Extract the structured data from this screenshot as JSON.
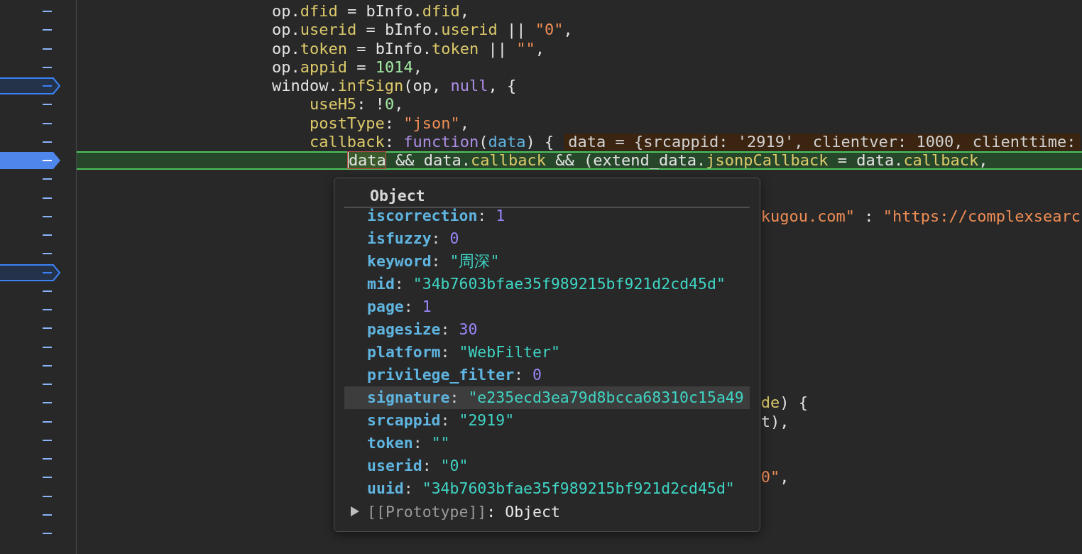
{
  "editor": {
    "rows": [
      {
        "breakpoint": false,
        "current": false,
        "tokens": [
          {
            "text": "                    op.",
            "kind": "plain"
          },
          {
            "text": "dfid",
            "kind": "prop"
          },
          {
            "text": " = bInfo.",
            "kind": "plain"
          },
          {
            "text": "dfid",
            "kind": "prop"
          },
          {
            "text": ",",
            "kind": "plain"
          }
        ]
      },
      {
        "breakpoint": false,
        "current": false,
        "tokens": [
          {
            "text": "                    op.",
            "kind": "plain"
          },
          {
            "text": "userid",
            "kind": "prop"
          },
          {
            "text": " = bInfo.",
            "kind": "plain"
          },
          {
            "text": "userid",
            "kind": "prop"
          },
          {
            "text": " || ",
            "kind": "plain"
          },
          {
            "text": "\"0\"",
            "kind": "string"
          },
          {
            "text": ",",
            "kind": "plain"
          }
        ]
      },
      {
        "breakpoint": false,
        "current": false,
        "tokens": [
          {
            "text": "                    op.",
            "kind": "plain"
          },
          {
            "text": "token",
            "kind": "prop"
          },
          {
            "text": " = bInfo.",
            "kind": "plain"
          },
          {
            "text": "token",
            "kind": "prop"
          },
          {
            "text": " || ",
            "kind": "plain"
          },
          {
            "text": "\"\"",
            "kind": "string"
          },
          {
            "text": ",",
            "kind": "plain"
          }
        ]
      },
      {
        "breakpoint": false,
        "current": false,
        "tokens": [
          {
            "text": "                    op.",
            "kind": "plain"
          },
          {
            "text": "appid",
            "kind": "prop"
          },
          {
            "text": " = ",
            "kind": "plain"
          },
          {
            "text": "1014",
            "kind": "number"
          },
          {
            "text": ",",
            "kind": "plain"
          }
        ]
      },
      {
        "breakpoint": true,
        "current": false,
        "tokens": [
          {
            "text": "                    window.",
            "kind": "plain"
          },
          {
            "text": "infSign",
            "kind": "prop"
          },
          {
            "text": "(op, ",
            "kind": "plain"
          },
          {
            "text": "null",
            "kind": "keyword"
          },
          {
            "text": ", {",
            "kind": "plain"
          }
        ]
      },
      {
        "breakpoint": false,
        "current": false,
        "tokens": [
          {
            "text": "                        useH5",
            "kind": "prop"
          },
          {
            "text": ": !",
            "kind": "plain"
          },
          {
            "text": "0",
            "kind": "number"
          },
          {
            "text": ",",
            "kind": "plain"
          }
        ]
      },
      {
        "breakpoint": false,
        "current": false,
        "tokens": [
          {
            "text": "                        postType",
            "kind": "prop"
          },
          {
            "text": ": ",
            "kind": "plain"
          },
          {
            "text": "\"json\"",
            "kind": "string"
          },
          {
            "text": ",",
            "kind": "plain"
          }
        ]
      },
      {
        "breakpoint": false,
        "current": false,
        "tokens": [
          {
            "text": "                        callback",
            "kind": "prop"
          },
          {
            "text": ": ",
            "kind": "plain"
          },
          {
            "text": "function",
            "kind": "keyword"
          },
          {
            "text": "(",
            "kind": "plain"
          },
          {
            "text": "data",
            "kind": "param"
          },
          {
            "text": ") {",
            "kind": "plain"
          }
        ],
        "inline_value": "data = {srcappid: '2919', clientver: 1000, clienttime:"
      },
      {
        "breakpoint": true,
        "current": true,
        "tokens": [
          {
            "text": "                            data",
            "kind": "hover"
          },
          {
            "text": " && data.",
            "kind": "plain"
          },
          {
            "text": "callback",
            "kind": "prop"
          },
          {
            "text": " && (extend_data.",
            "kind": "plain"
          },
          {
            "text": "jsonpCallback",
            "kind": "prop"
          },
          {
            "text": " = data.",
            "kind": "plain"
          },
          {
            "text": "callback",
            "kind": "prop"
          },
          {
            "text": ",",
            "kind": "plain"
          }
        ]
      },
      {
        "breakpoint": false,
        "current": false
      },
      {
        "breakpoint": false,
        "current": false
      },
      {
        "breakpoint": false,
        "current": false,
        "tokens": [
          {
            "text": "                                                                        kugou.com\"",
            "kind": "string"
          },
          {
            "text": " : ",
            "kind": "plain"
          },
          {
            "text": "\"https://complexsearc",
            "kind": "string"
          }
        ]
      },
      {
        "breakpoint": false,
        "current": false
      },
      {
        "breakpoint": false,
        "current": false
      },
      {
        "breakpoint": true,
        "current": false
      },
      {
        "breakpoint": false,
        "current": false
      },
      {
        "breakpoint": false,
        "current": false
      },
      {
        "breakpoint": false,
        "current": false
      },
      {
        "breakpoint": false,
        "current": false
      },
      {
        "breakpoint": false,
        "current": false
      },
      {
        "breakpoint": false,
        "current": false
      },
      {
        "breakpoint": false,
        "current": false,
        "tokens": [
          {
            "text": "                                                                        de",
            "kind": "prop"
          },
          {
            "text": ") {",
            "kind": "plain"
          }
        ]
      },
      {
        "breakpoint": false,
        "current": false,
        "tokens": [
          {
            "text": "                                                                        t),",
            "kind": "plain"
          }
        ]
      },
      {
        "breakpoint": false,
        "current": false
      },
      {
        "breakpoint": false,
        "current": false
      },
      {
        "breakpoint": false,
        "current": false,
        "tokens": [
          {
            "text": "                                                                        0\"",
            "kind": "string"
          },
          {
            "text": ",",
            "kind": "plain"
          }
        ]
      },
      {
        "breakpoint": false,
        "current": false
      },
      {
        "breakpoint": false,
        "current": false
      },
      {
        "breakpoint": false,
        "current": false
      }
    ]
  },
  "popover": {
    "title": "Object",
    "properties": [
      {
        "key": "iscorrection:",
        "value": "1",
        "kind": "number",
        "selected": false
      },
      {
        "key": "isfuzzy:",
        "value": "0",
        "kind": "number",
        "selected": false
      },
      {
        "key": "keyword:",
        "value": "\"周深\"",
        "kind": "string",
        "selected": false
      },
      {
        "key": "mid:",
        "value": "\"34b7603bfae35f989215bf921d2cd45d\"",
        "kind": "string",
        "selected": false
      },
      {
        "key": "page:",
        "value": "1",
        "kind": "number",
        "selected": false
      },
      {
        "key": "pagesize:",
        "value": "30",
        "kind": "number",
        "selected": false
      },
      {
        "key": "platform:",
        "value": "\"WebFilter\"",
        "kind": "string",
        "selected": false
      },
      {
        "key": "privilege_filter:",
        "value": "0",
        "kind": "number",
        "selected": false
      },
      {
        "key": "signature:",
        "value": "\"e235ecd3ea79d8bcca68310c15a49",
        "kind": "string",
        "selected": true
      },
      {
        "key": "srcappid:",
        "value": "\"2919\"",
        "kind": "string",
        "selected": false
      },
      {
        "key": "token:",
        "value": "\"\"",
        "kind": "string",
        "selected": false
      },
      {
        "key": "userid:",
        "value": "\"0\"",
        "kind": "string",
        "selected": false
      },
      {
        "key": "uuid:",
        "value": "\"34b7603bfae35f989215bf921d2cd45d\"",
        "kind": "string",
        "selected": false
      }
    ],
    "prototype": {
      "label": "[[Prototype]]:",
      "value": "Object",
      "expanded": false
    }
  }
}
